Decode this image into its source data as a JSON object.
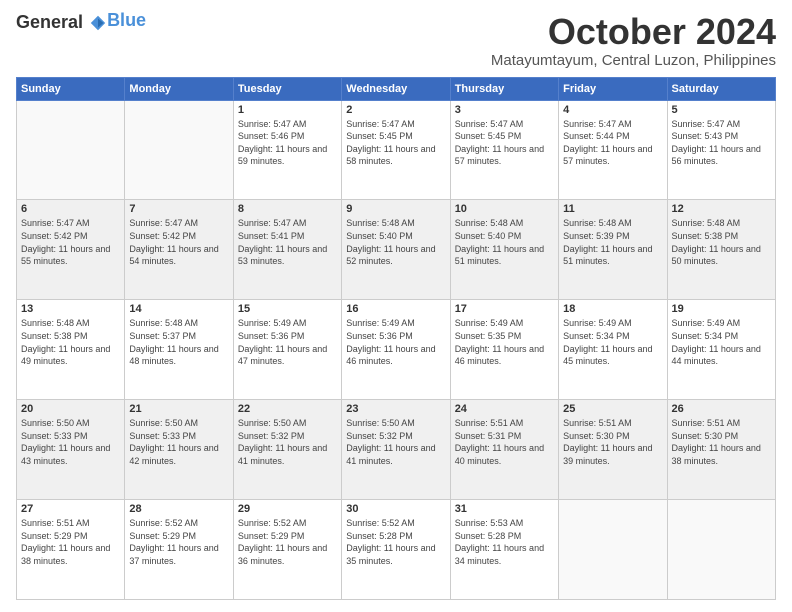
{
  "logo": {
    "general": "General",
    "blue": "Blue"
  },
  "header": {
    "month": "October 2024",
    "location": "Matayumtayum, Central Luzon, Philippines"
  },
  "weekdays": [
    "Sunday",
    "Monday",
    "Tuesday",
    "Wednesday",
    "Thursday",
    "Friday",
    "Saturday"
  ],
  "weeks": [
    [
      {
        "day": "",
        "sunrise": "",
        "sunset": "",
        "daylight": ""
      },
      {
        "day": "",
        "sunrise": "",
        "sunset": "",
        "daylight": ""
      },
      {
        "day": "1",
        "sunrise": "Sunrise: 5:47 AM",
        "sunset": "Sunset: 5:46 PM",
        "daylight": "Daylight: 11 hours and 59 minutes."
      },
      {
        "day": "2",
        "sunrise": "Sunrise: 5:47 AM",
        "sunset": "Sunset: 5:45 PM",
        "daylight": "Daylight: 11 hours and 58 minutes."
      },
      {
        "day": "3",
        "sunrise": "Sunrise: 5:47 AM",
        "sunset": "Sunset: 5:45 PM",
        "daylight": "Daylight: 11 hours and 57 minutes."
      },
      {
        "day": "4",
        "sunrise": "Sunrise: 5:47 AM",
        "sunset": "Sunset: 5:44 PM",
        "daylight": "Daylight: 11 hours and 57 minutes."
      },
      {
        "day": "5",
        "sunrise": "Sunrise: 5:47 AM",
        "sunset": "Sunset: 5:43 PM",
        "daylight": "Daylight: 11 hours and 56 minutes."
      }
    ],
    [
      {
        "day": "6",
        "sunrise": "Sunrise: 5:47 AM",
        "sunset": "Sunset: 5:42 PM",
        "daylight": "Daylight: 11 hours and 55 minutes."
      },
      {
        "day": "7",
        "sunrise": "Sunrise: 5:47 AM",
        "sunset": "Sunset: 5:42 PM",
        "daylight": "Daylight: 11 hours and 54 minutes."
      },
      {
        "day": "8",
        "sunrise": "Sunrise: 5:47 AM",
        "sunset": "Sunset: 5:41 PM",
        "daylight": "Daylight: 11 hours and 53 minutes."
      },
      {
        "day": "9",
        "sunrise": "Sunrise: 5:48 AM",
        "sunset": "Sunset: 5:40 PM",
        "daylight": "Daylight: 11 hours and 52 minutes."
      },
      {
        "day": "10",
        "sunrise": "Sunrise: 5:48 AM",
        "sunset": "Sunset: 5:40 PM",
        "daylight": "Daylight: 11 hours and 51 minutes."
      },
      {
        "day": "11",
        "sunrise": "Sunrise: 5:48 AM",
        "sunset": "Sunset: 5:39 PM",
        "daylight": "Daylight: 11 hours and 51 minutes."
      },
      {
        "day": "12",
        "sunrise": "Sunrise: 5:48 AM",
        "sunset": "Sunset: 5:38 PM",
        "daylight": "Daylight: 11 hours and 50 minutes."
      }
    ],
    [
      {
        "day": "13",
        "sunrise": "Sunrise: 5:48 AM",
        "sunset": "Sunset: 5:38 PM",
        "daylight": "Daylight: 11 hours and 49 minutes."
      },
      {
        "day": "14",
        "sunrise": "Sunrise: 5:48 AM",
        "sunset": "Sunset: 5:37 PM",
        "daylight": "Daylight: 11 hours and 48 minutes."
      },
      {
        "day": "15",
        "sunrise": "Sunrise: 5:49 AM",
        "sunset": "Sunset: 5:36 PM",
        "daylight": "Daylight: 11 hours and 47 minutes."
      },
      {
        "day": "16",
        "sunrise": "Sunrise: 5:49 AM",
        "sunset": "Sunset: 5:36 PM",
        "daylight": "Daylight: 11 hours and 46 minutes."
      },
      {
        "day": "17",
        "sunrise": "Sunrise: 5:49 AM",
        "sunset": "Sunset: 5:35 PM",
        "daylight": "Daylight: 11 hours and 46 minutes."
      },
      {
        "day": "18",
        "sunrise": "Sunrise: 5:49 AM",
        "sunset": "Sunset: 5:34 PM",
        "daylight": "Daylight: 11 hours and 45 minutes."
      },
      {
        "day": "19",
        "sunrise": "Sunrise: 5:49 AM",
        "sunset": "Sunset: 5:34 PM",
        "daylight": "Daylight: 11 hours and 44 minutes."
      }
    ],
    [
      {
        "day": "20",
        "sunrise": "Sunrise: 5:50 AM",
        "sunset": "Sunset: 5:33 PM",
        "daylight": "Daylight: 11 hours and 43 minutes."
      },
      {
        "day": "21",
        "sunrise": "Sunrise: 5:50 AM",
        "sunset": "Sunset: 5:33 PM",
        "daylight": "Daylight: 11 hours and 42 minutes."
      },
      {
        "day": "22",
        "sunrise": "Sunrise: 5:50 AM",
        "sunset": "Sunset: 5:32 PM",
        "daylight": "Daylight: 11 hours and 41 minutes."
      },
      {
        "day": "23",
        "sunrise": "Sunrise: 5:50 AM",
        "sunset": "Sunset: 5:32 PM",
        "daylight": "Daylight: 11 hours and 41 minutes."
      },
      {
        "day": "24",
        "sunrise": "Sunrise: 5:51 AM",
        "sunset": "Sunset: 5:31 PM",
        "daylight": "Daylight: 11 hours and 40 minutes."
      },
      {
        "day": "25",
        "sunrise": "Sunrise: 5:51 AM",
        "sunset": "Sunset: 5:30 PM",
        "daylight": "Daylight: 11 hours and 39 minutes."
      },
      {
        "day": "26",
        "sunrise": "Sunrise: 5:51 AM",
        "sunset": "Sunset: 5:30 PM",
        "daylight": "Daylight: 11 hours and 38 minutes."
      }
    ],
    [
      {
        "day": "27",
        "sunrise": "Sunrise: 5:51 AM",
        "sunset": "Sunset: 5:29 PM",
        "daylight": "Daylight: 11 hours and 38 minutes."
      },
      {
        "day": "28",
        "sunrise": "Sunrise: 5:52 AM",
        "sunset": "Sunset: 5:29 PM",
        "daylight": "Daylight: 11 hours and 37 minutes."
      },
      {
        "day": "29",
        "sunrise": "Sunrise: 5:52 AM",
        "sunset": "Sunset: 5:29 PM",
        "daylight": "Daylight: 11 hours and 36 minutes."
      },
      {
        "day": "30",
        "sunrise": "Sunrise: 5:52 AM",
        "sunset": "Sunset: 5:28 PM",
        "daylight": "Daylight: 11 hours and 35 minutes."
      },
      {
        "day": "31",
        "sunrise": "Sunrise: 5:53 AM",
        "sunset": "Sunset: 5:28 PM",
        "daylight": "Daylight: 11 hours and 34 minutes."
      },
      {
        "day": "",
        "sunrise": "",
        "sunset": "",
        "daylight": ""
      },
      {
        "day": "",
        "sunrise": "",
        "sunset": "",
        "daylight": ""
      }
    ]
  ]
}
